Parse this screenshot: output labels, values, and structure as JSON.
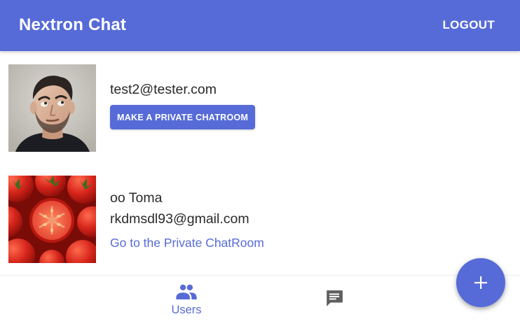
{
  "header": {
    "title": "Nextron Chat",
    "logout_label": "LOGOUT"
  },
  "users": [
    {
      "email": "test2@tester.com",
      "action_label": "MAKE A PRIVATE CHATROOM",
      "avatar_icon": "man-portrait-avatar"
    },
    {
      "name": "oo Toma",
      "email": "rkdmsdl93@gmail.com",
      "action_label": "Go to the Private ChatRoom",
      "avatar_icon": "tomatoes-avatar"
    }
  ],
  "bottom_nav": {
    "items": [
      {
        "label": "Users",
        "icon": "people-icon",
        "active": true
      },
      {
        "label": "",
        "icon": "chat-icon",
        "active": false
      }
    ]
  },
  "fab": {
    "icon": "plus-icon"
  },
  "colors": {
    "primary": "#566bd7",
    "inactive_icon": "#5f5f5f",
    "text": "#2a2a2a"
  }
}
